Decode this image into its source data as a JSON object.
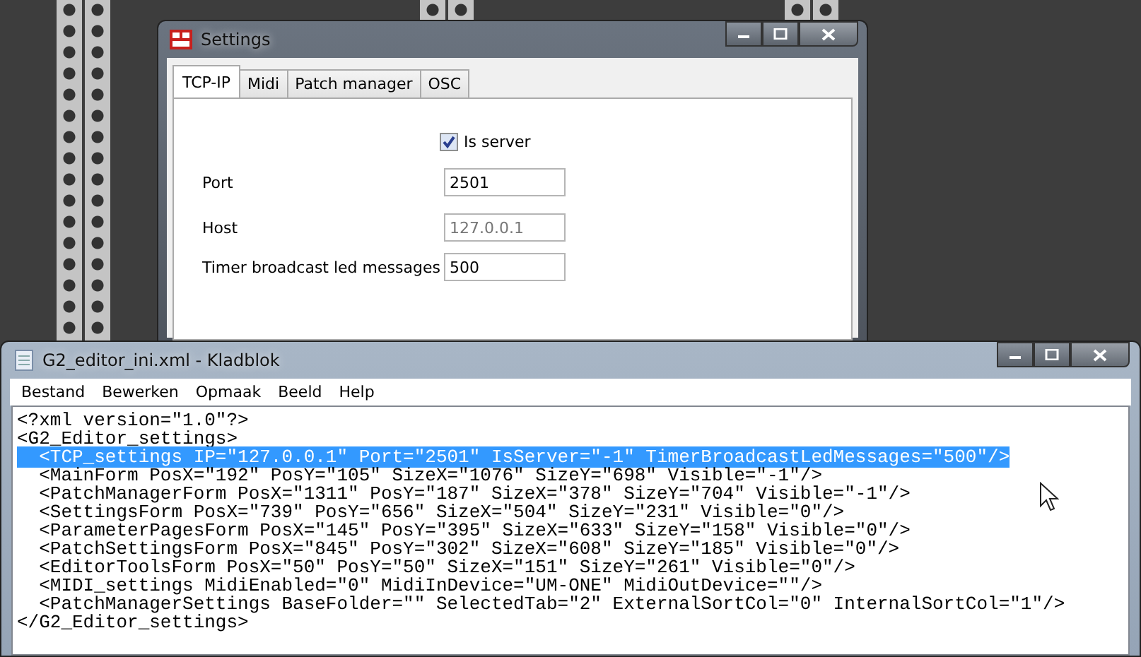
{
  "settings_window": {
    "title": "Settings",
    "tabs": [
      {
        "label": "TCP-IP",
        "selected": true
      },
      {
        "label": "Midi",
        "selected": false
      },
      {
        "label": "Patch manager",
        "selected": false
      },
      {
        "label": "OSC",
        "selected": false
      }
    ],
    "is_server": {
      "label": "Is server",
      "checked": true
    },
    "fields": [
      {
        "label": "Port",
        "value": "2501",
        "disabled": false
      },
      {
        "label": "Host",
        "value": "127.0.0.1",
        "disabled": true
      },
      {
        "label": "Timer broadcast led messages",
        "value": "500",
        "disabled": false
      }
    ]
  },
  "notepad_window": {
    "title": "G2_editor_ini.xml - Kladblok",
    "menu": [
      "Bestand",
      "Bewerken",
      "Opmaak",
      "Beeld",
      "Help"
    ],
    "lines": [
      {
        "text": "<?xml version=\"1.0\"?>",
        "selected": false
      },
      {
        "text": "<G2_Editor_settings>",
        "selected": false
      },
      {
        "text": "  <TCP_settings IP=\"127.0.0.1\" Port=\"2501\" IsServer=\"-1\" TimerBroadcastLedMessages=\"500\"/>",
        "selected": true
      },
      {
        "text": "  <MainForm PosX=\"192\" PosY=\"105\" SizeX=\"1076\" SizeY=\"698\" Visible=\"-1\"/>",
        "selected": false
      },
      {
        "text": "  <PatchManagerForm PosX=\"1311\" PosY=\"187\" SizeX=\"378\" SizeY=\"704\" Visible=\"-1\"/>",
        "selected": false
      },
      {
        "text": "  <SettingsForm PosX=\"739\" PosY=\"656\" SizeX=\"504\" SizeY=\"231\" Visible=\"0\"/>",
        "selected": false
      },
      {
        "text": "  <ParameterPagesForm PosX=\"145\" PosY=\"395\" SizeX=\"633\" SizeY=\"158\" Visible=\"0\"/>",
        "selected": false
      },
      {
        "text": "  <PatchSettingsForm PosX=\"845\" PosY=\"302\" SizeX=\"608\" SizeY=\"185\" Visible=\"0\"/>",
        "selected": false
      },
      {
        "text": "  <EditorToolsForm PosX=\"50\" PosY=\"50\" SizeX=\"151\" SizeY=\"261\" Visible=\"0\"/>",
        "selected": false
      },
      {
        "text": "  <MIDI_settings MidiEnabled=\"0\" MidiInDevice=\"UM-ONE\" MidiOutDevice=\"\"/>",
        "selected": false
      },
      {
        "text": "  <PatchManagerSettings BaseFolder=\"\" SelectedTab=\"2\" ExternalSortCol=\"0\" InternalSortCol=\"1\"/>",
        "selected": false
      },
      {
        "text": "</G2_Editor_settings>",
        "selected": false
      }
    ]
  }
}
